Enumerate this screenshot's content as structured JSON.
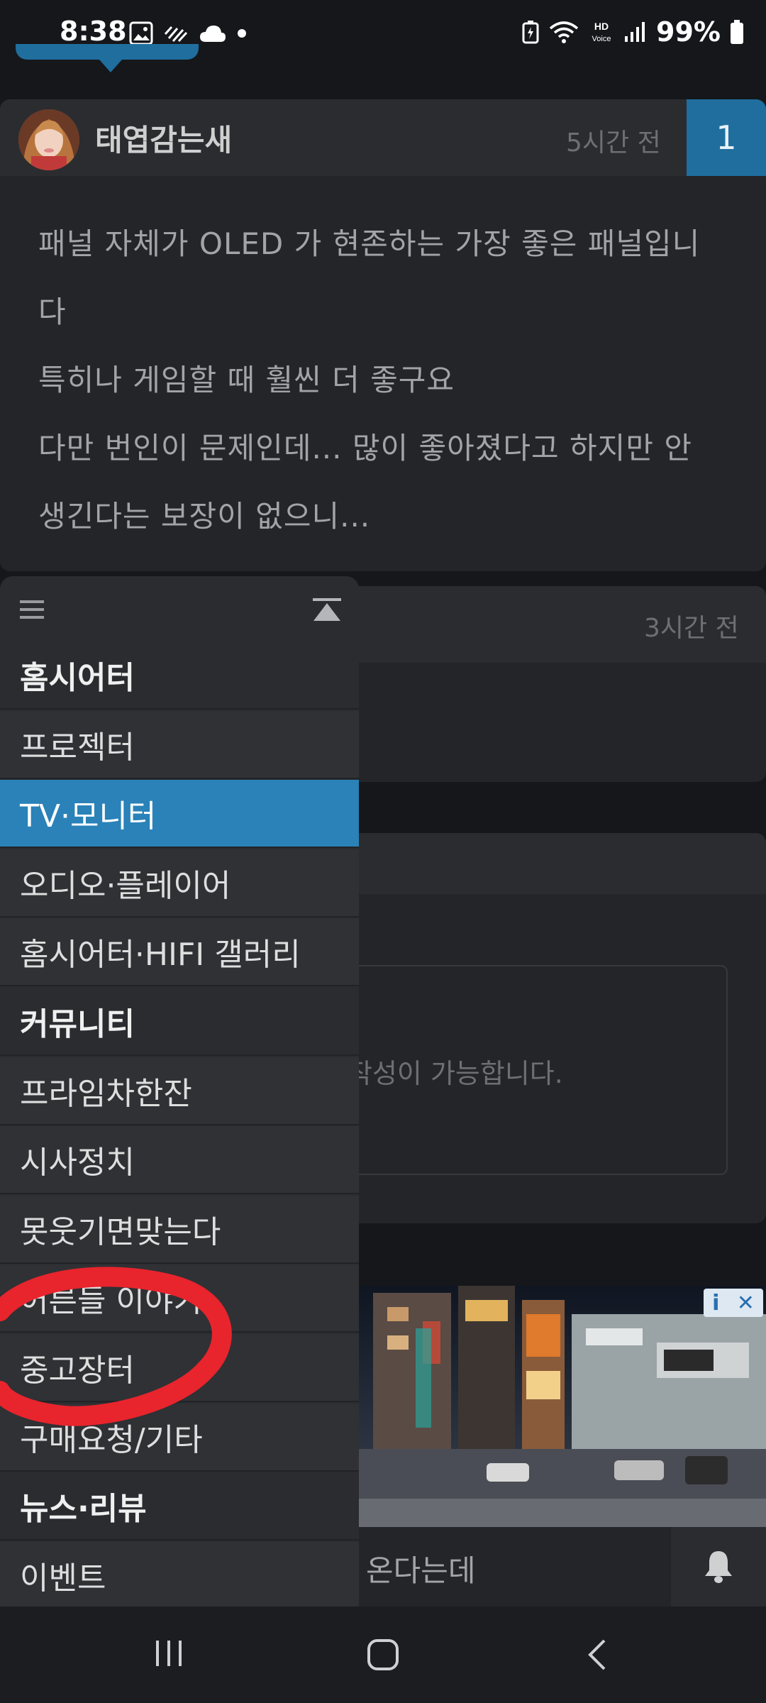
{
  "status_bar": {
    "time": "8:38",
    "battery": "99%",
    "icons": [
      "image-icon",
      "missed-call-icon",
      "cloud-icon",
      "dot-icon",
      "battery-saver-icon",
      "wifi-icon",
      "hd-voice-icon",
      "signal-icon",
      "battery-icon"
    ]
  },
  "comment1": {
    "author": "태엽감는새",
    "time": "5시간 전",
    "number": "1",
    "lines": [
      "패널 자체가 OLED 가 현존하는 가장 좋은 패널입니",
      "다",
      "특히나 게임할 때 훨씬 더 좋구요",
      "다만 번인이 문제인데... 많이 좋아졌다고 하지만 안",
      "생긴다는 보장이 없으니..."
    ]
  },
  "comment2": {
    "time": "3시간 전"
  },
  "reply": {
    "placeholder_fragment": "작성이 가능합니다."
  },
  "ad": {
    "info_label": "i",
    "close_label": "✕"
  },
  "bottom_bar": {
    "text": "온다는데"
  },
  "menu": {
    "items": [
      {
        "label": "홈시어터",
        "type": "section"
      },
      {
        "label": "프로젝터",
        "type": "link"
      },
      {
        "label": "TV·모니터",
        "type": "active"
      },
      {
        "label": "오디오·플레이어",
        "type": "link"
      },
      {
        "label": "홈시어터·HIFI 갤러리",
        "type": "link"
      },
      {
        "label": "커뮤니티",
        "type": "section"
      },
      {
        "label": "프라임차한잔",
        "type": "link"
      },
      {
        "label": "시사정치",
        "type": "link"
      },
      {
        "label": "못웃기면맞는다",
        "type": "link"
      },
      {
        "label": "어른들 이야기",
        "type": "link"
      },
      {
        "label": "중고장터",
        "type": "link"
      },
      {
        "label": "구매요청/기타",
        "type": "link"
      },
      {
        "label": "뉴스·리뷰",
        "type": "section"
      },
      {
        "label": "이벤트",
        "type": "link"
      }
    ]
  },
  "colors": {
    "accent": "#2a82b8",
    "badge": "#1f6e9e",
    "annotation": "#e8242c"
  }
}
